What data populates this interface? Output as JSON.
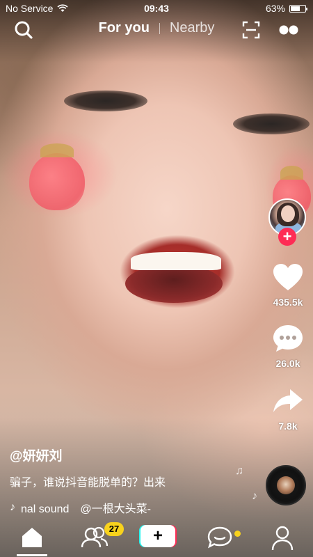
{
  "status_bar": {
    "carrier": "No Service",
    "time": "09:43",
    "battery_percent": "63%",
    "battery_level": 0.63
  },
  "top_nav": {
    "tab_for_you": "For you",
    "tab_nearby": "Nearby",
    "icons": [
      "search-icon",
      "scan-icon",
      "more-icon"
    ]
  },
  "rail": {
    "like_count": "435.5k",
    "comment_count": "26.0k",
    "share_count": "7.8k",
    "follow_label": "+"
  },
  "caption": {
    "username": "@妍妍刘",
    "text": "骗子，谁说抖音能脱单的？出来",
    "music_prefix": "♪",
    "music_text": "nal sound　@一根大头菜-"
  },
  "bottom_nav": {
    "friends_badge": "27",
    "create_label": "+",
    "icons": [
      "home-icon",
      "friends-icon",
      "create-icon",
      "inbox-icon",
      "profile-icon"
    ]
  },
  "colors": {
    "accent_red": "#fe2c55",
    "accent_cyan": "#25f4ee",
    "badge_yellow": "#f8d21c"
  }
}
